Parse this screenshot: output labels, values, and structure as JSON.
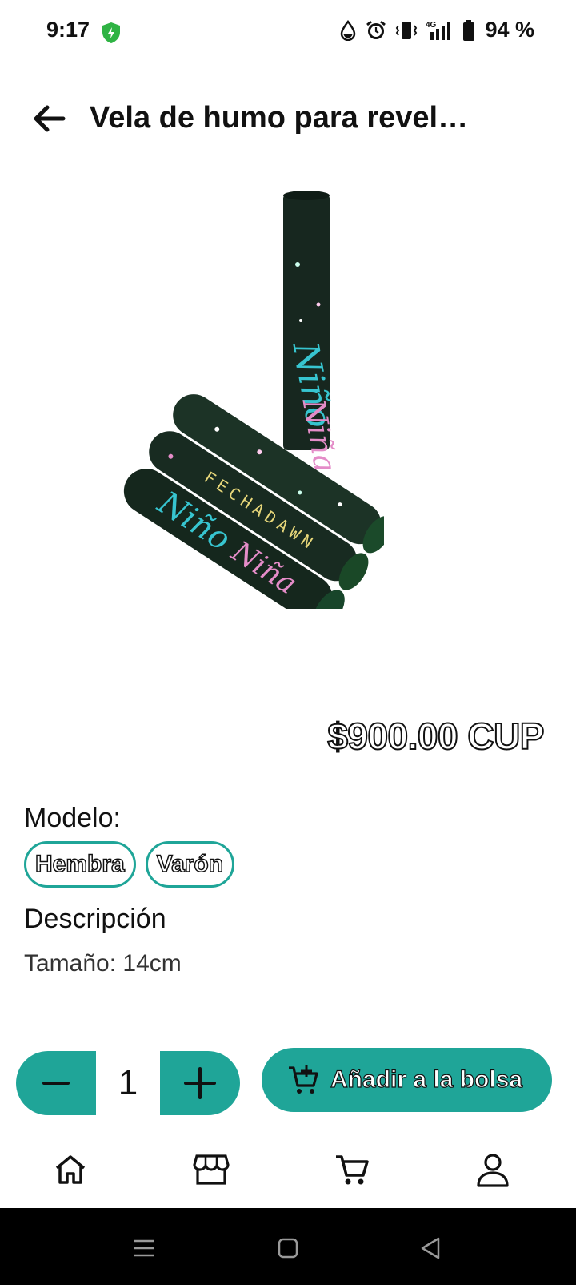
{
  "status_bar": {
    "time": "9:17",
    "battery": "94 %",
    "network": "4G",
    "icons": [
      "shield-check-icon",
      "drop-icon",
      "alarm-icon",
      "vibrate-icon",
      "signal-icon",
      "battery-icon"
    ]
  },
  "header": {
    "title": "Vela de humo para revel…",
    "back_icon": "arrow-left-icon"
  },
  "product": {
    "image_icon": "smoke-candle-image",
    "price": "$900.00 CUP",
    "model_label": "Modelo:",
    "models": [
      "Hembra",
      "Varón"
    ],
    "description_title": "Descripción",
    "description": "Tamaño: 14cm"
  },
  "cart": {
    "quantity": "1",
    "add_label": "Añadir a la bolsa"
  },
  "bottom_nav": {
    "items": [
      "home-icon",
      "store-icon",
      "cart-icon",
      "profile-icon"
    ]
  },
  "colors": {
    "accent": "#1fa598",
    "text": "#111111",
    "system_nav": "#000000"
  }
}
